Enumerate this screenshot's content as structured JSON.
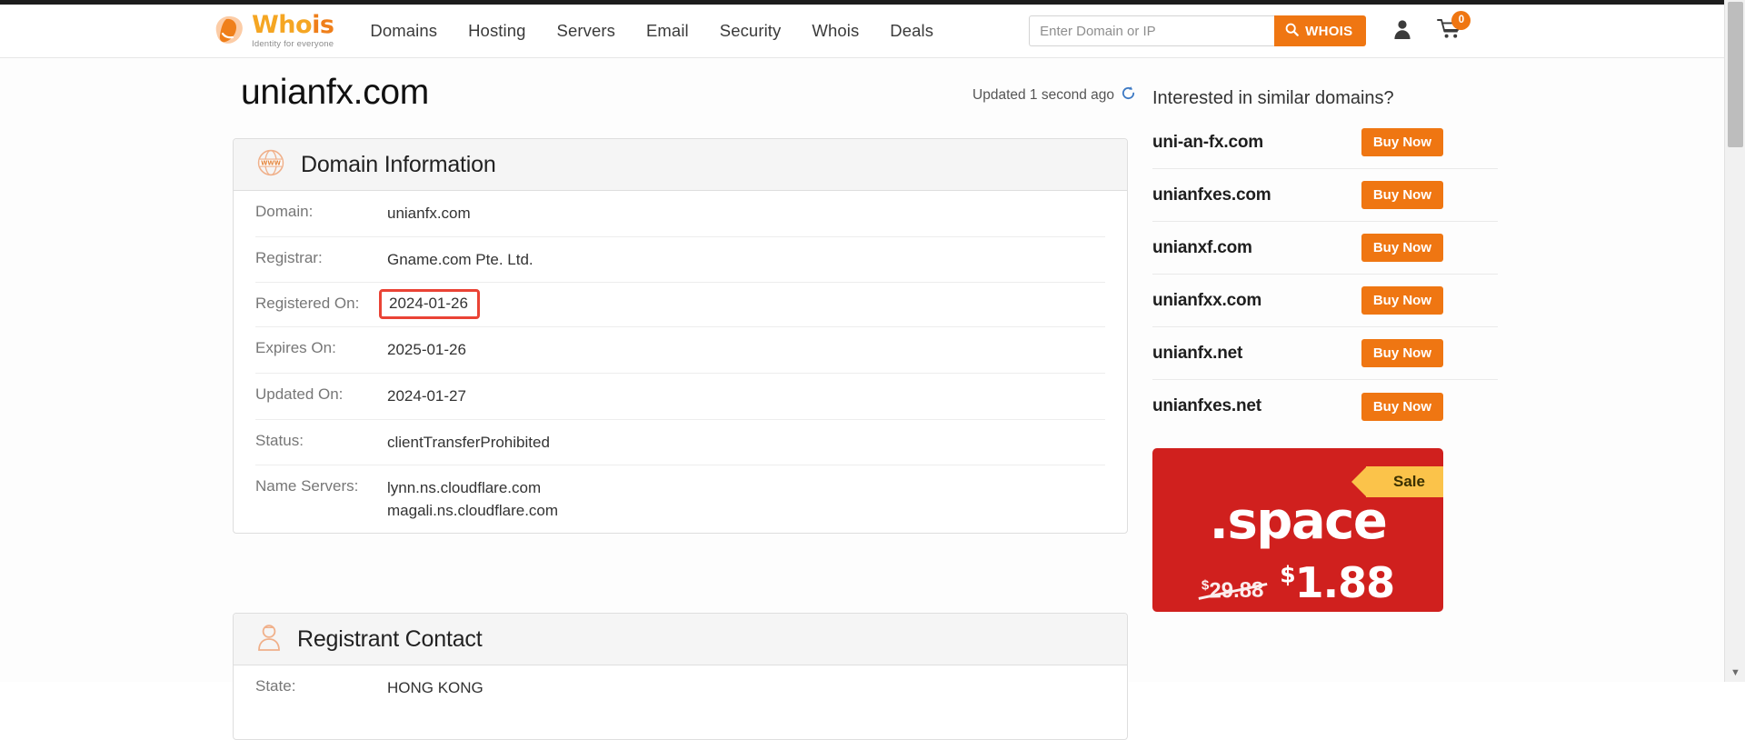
{
  "browser": {
    "scroll_down_arrow": "▼"
  },
  "header": {
    "logo": {
      "word_part1": "Who",
      "word_part2": "is",
      "tagline": "Identity for everyone"
    },
    "nav": [
      {
        "label": "Domains"
      },
      {
        "label": "Hosting"
      },
      {
        "label": "Servers"
      },
      {
        "label": "Email"
      },
      {
        "label": "Security"
      },
      {
        "label": "Whois"
      },
      {
        "label": "Deals"
      }
    ],
    "search": {
      "placeholder": "Enter Domain or IP",
      "value": "",
      "button_label": "WHOIS"
    },
    "cart_count": "0"
  },
  "main": {
    "page_title": "unianfx.com",
    "updated_text": "Updated 1 second ago",
    "panels": [
      {
        "id": "domain-information",
        "title": "Domain Information",
        "icon": "www-globe-icon",
        "rows": [
          {
            "label": "Domain:",
            "value": "unianfx.com",
            "highlighted": false
          },
          {
            "label": "Registrar:",
            "value": "Gname.com Pte. Ltd.",
            "highlighted": false
          },
          {
            "label": "Registered On:",
            "value": "2024-01-26",
            "highlighted": true
          },
          {
            "label": "Expires On:",
            "value": "2025-01-26",
            "highlighted": false
          },
          {
            "label": "Updated On:",
            "value": "2024-01-27",
            "highlighted": false
          },
          {
            "label": "Status:",
            "value": "clientTransferProhibited",
            "highlighted": false
          },
          {
            "label": "Name Servers:",
            "value": "lynn.ns.cloudflare.com\nmagali.ns.cloudflare.com",
            "highlighted": false
          }
        ]
      },
      {
        "id": "registrant-contact",
        "title": "Registrant Contact",
        "icon": "person-icon",
        "rows": [
          {
            "label": "State:",
            "value": "HONG KONG",
            "highlighted": false
          }
        ]
      }
    ]
  },
  "sidebar": {
    "heading": "Interested in similar domains?",
    "buy_label": "Buy Now",
    "suggestions": [
      {
        "domain": "uni-an-fx.com"
      },
      {
        "domain": "unianfxes.com"
      },
      {
        "domain": "unianxf.com"
      },
      {
        "domain": "unianfxx.com"
      },
      {
        "domain": "unianfx.net"
      },
      {
        "domain": "unianfxes.net"
      }
    ],
    "promo": {
      "ribbon": "Sale",
      "tld": ".space",
      "old_currency": "$",
      "old_price": "29.88",
      "new_currency": "$",
      "new_price": "1.88"
    }
  },
  "colors": {
    "brand_orange": "#ef7612",
    "logo_yellow": "#f5a623",
    "promo_red": "#d0201e",
    "ribbon_yellow": "#fbc34a",
    "highlight_red": "#ea4335",
    "refresh_blue": "#3b78c3"
  }
}
